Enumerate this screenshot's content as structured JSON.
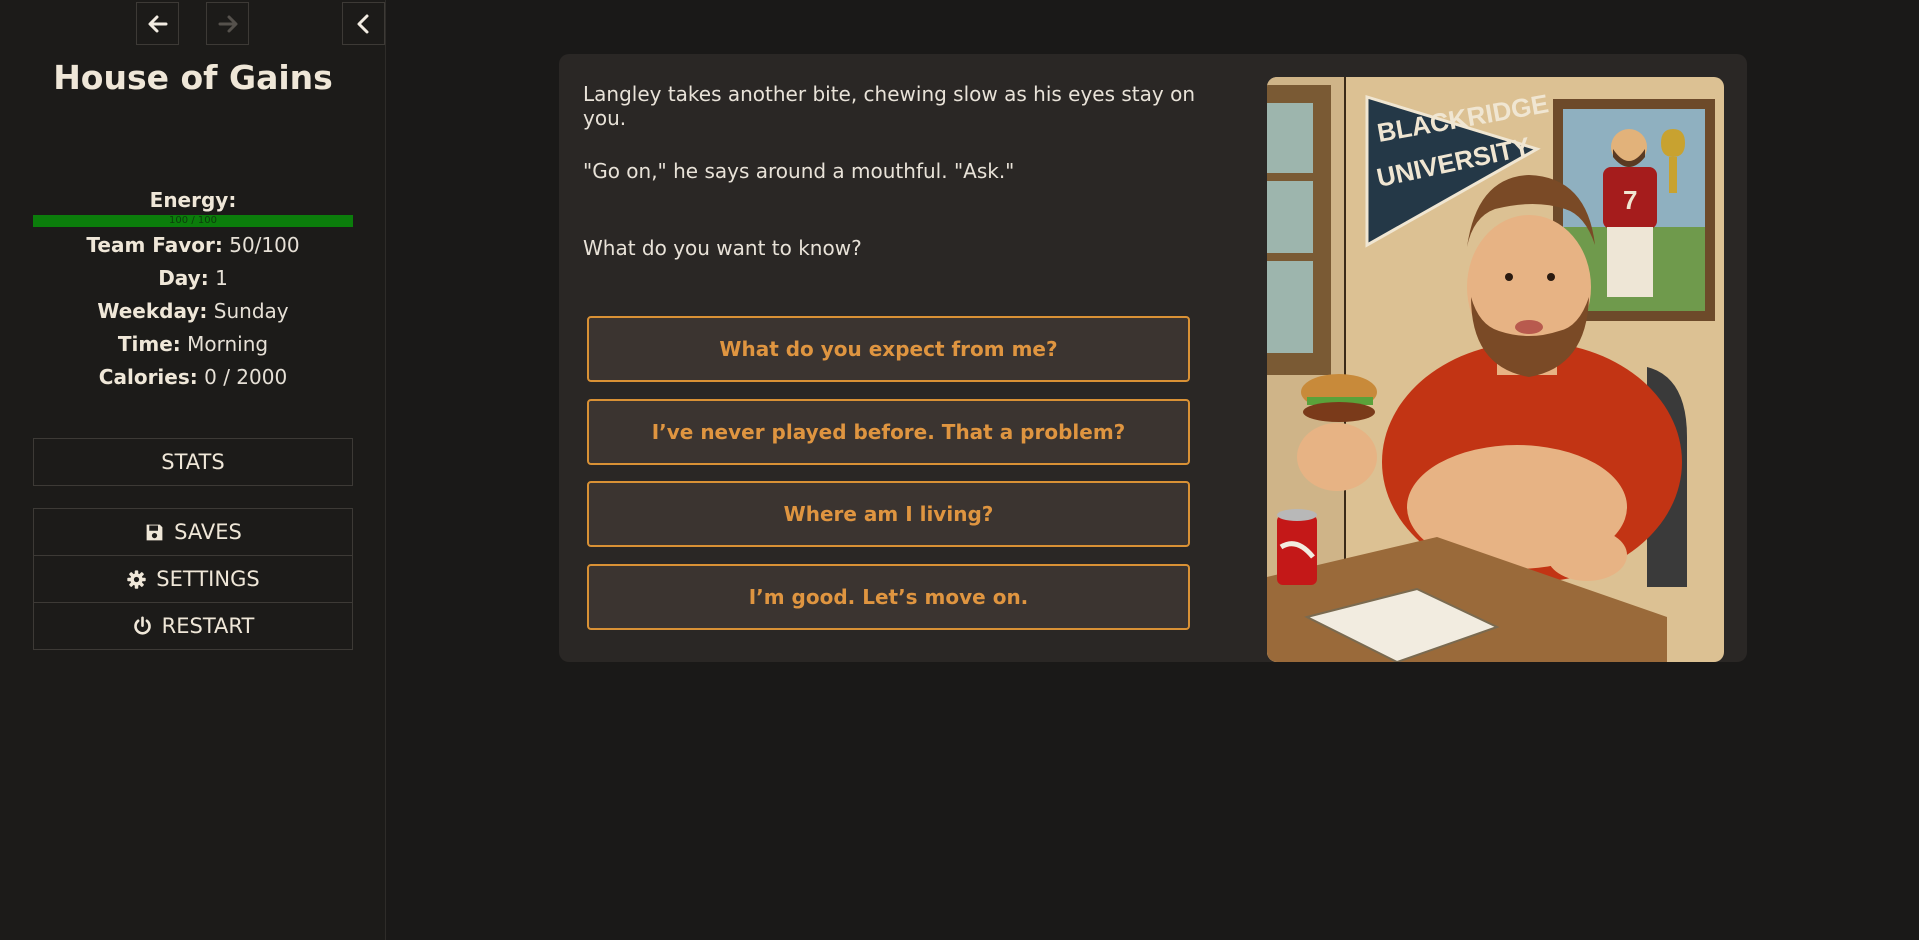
{
  "sidebar": {
    "title": "House of Gains",
    "energy": {
      "label": "Energy:",
      "value": 100,
      "max": 100,
      "text": "100 / 100",
      "color": "#0b7d0b"
    },
    "stats": [
      {
        "label": "Team Favor:",
        "value": "50/100"
      },
      {
        "label": "Day:",
        "value": "1"
      },
      {
        "label": "Weekday:",
        "value": "Sunday"
      },
      {
        "label": "Time:",
        "value": "Morning"
      },
      {
        "label": "Calories:",
        "value": "0 / 2000"
      }
    ],
    "buttons": {
      "stats": "STATS",
      "saves": "SAVES",
      "settings": "SETTINGS",
      "restart": "RESTART"
    },
    "icons": {
      "back": "arrow-left-icon",
      "forward": "arrow-right-icon",
      "collapse": "chevron-left-icon",
      "saves": "floppy-disk-icon",
      "settings": "gear-icon",
      "restart": "power-icon"
    }
  },
  "passage": {
    "paragraphs": [
      "Langley takes another bite, chewing slow as his eyes stay on you.",
      "\"Go on,\" he says around a mouthful. \"Ask.\"",
      "What do you want to know?"
    ],
    "choices": [
      "What do you expect from me?",
      "I’ve never played before. That a problem?",
      "Where am I living?",
      "I’m good. Let’s move on."
    ],
    "illustration": {
      "pennant_text_1": "BLACKRIDGE",
      "pennant_text_2": "UNIVERSITY",
      "jersey_number": "7"
    }
  },
  "colors": {
    "accent": "#df9540",
    "choice_border": "#d99135",
    "panel": "#2a2725",
    "background": "#1a1918"
  }
}
